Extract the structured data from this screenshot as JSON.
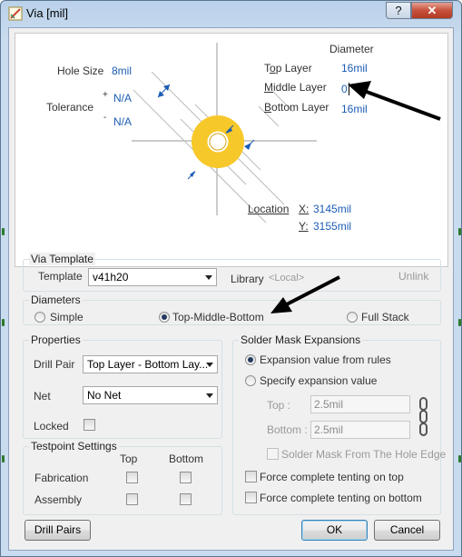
{
  "window": {
    "title": "Via [mil]",
    "help_label": "?",
    "close_label": "✕"
  },
  "graphic": {
    "hole_size_label": "Hole Size",
    "hole_size_value": "8mil",
    "tolerance_label": "Tolerance",
    "tol_plus_sign": "+",
    "tol_plus_value": "N/A",
    "tol_minus_sign": "-",
    "tol_minus_value": "N/A",
    "diameter_heading": "Diameter",
    "top_layer_pre": "T",
    "top_layer_u": "o",
    "top_layer_post": "p Layer",
    "top_layer_value": "16mil",
    "middle_layer_pre": "",
    "middle_layer_u": "M",
    "middle_layer_post": "iddle Layer",
    "middle_layer_value": "0",
    "bottom_layer_pre": "",
    "bottom_layer_u": "B",
    "bottom_layer_post": "ottom Layer",
    "bottom_layer_value": "16mil",
    "location_label": "Location",
    "x_label": "X:",
    "x_value": "3145mil",
    "y_label": "Y:",
    "y_value": "3155mil"
  },
  "via_template": {
    "title": "Via Template",
    "template_label": "Template",
    "template_value": "v41h20",
    "library_label": "Library",
    "library_value": "<Local>",
    "unlink_label": "Unlink"
  },
  "diameters": {
    "title": "Diameters",
    "simple": "Simple",
    "tmb": "Top-Middle-Bottom",
    "full_stack": "Full Stack",
    "selected": "tmb"
  },
  "properties": {
    "title": "Properties",
    "drill_pair_label": "Drill Pair",
    "drill_pair_value": "Top Layer - Bottom Lay...",
    "net_label": "Net",
    "net_value": "No Net",
    "locked_label": "Locked"
  },
  "solder_mask": {
    "title": "Solder Mask Expansions",
    "from_rules": "Expansion value from rules",
    "specify": "Specify expansion value",
    "top_label": "Top :",
    "top_value": "2.5mil",
    "bottom_label": "Bottom :",
    "bottom_value": "2.5mil",
    "hole_edge": "Solder Mask From The Hole Edge",
    "tent_top": "Force complete tenting on top",
    "tent_bottom": "Force complete tenting on bottom"
  },
  "testpoint": {
    "title": "Testpoint Settings",
    "col_top": "Top",
    "col_bottom": "Bottom",
    "fabrication": "Fabrication",
    "assembly": "Assembly"
  },
  "buttons": {
    "drill_pairs": "Drill Pairs",
    "ok": "OK",
    "cancel": "Cancel"
  },
  "colors": {
    "pad": "#f7c82a",
    "value_text": "#1c5cb4",
    "arrow": "#000000"
  }
}
